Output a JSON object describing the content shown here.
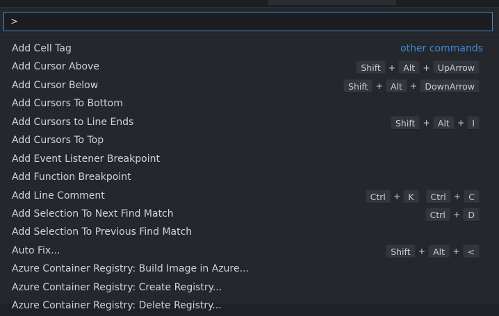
{
  "command_input": {
    "value": ">"
  },
  "other_commands_label": "other commands",
  "commands": [
    {
      "label": "Add Cell Tag",
      "link": true
    },
    {
      "label": "Add Cursor Above",
      "chords": [
        [
          "Shift",
          "Alt",
          "UpArrow"
        ]
      ]
    },
    {
      "label": "Add Cursor Below",
      "chords": [
        [
          "Shift",
          "Alt",
          "DownArrow"
        ]
      ]
    },
    {
      "label": "Add Cursors To Bottom"
    },
    {
      "label": "Add Cursors to Line Ends",
      "chords": [
        [
          "Shift",
          "Alt",
          "I"
        ]
      ]
    },
    {
      "label": "Add Cursors To Top"
    },
    {
      "label": "Add Event Listener Breakpoint"
    },
    {
      "label": "Add Function Breakpoint"
    },
    {
      "label": "Add Line Comment",
      "chords": [
        [
          "Ctrl",
          "K"
        ],
        [
          "Ctrl",
          "C"
        ]
      ]
    },
    {
      "label": "Add Selection To Next Find Match",
      "chords": [
        [
          "Ctrl",
          "D"
        ]
      ]
    },
    {
      "label": "Add Selection To Previous Find Match"
    },
    {
      "label": "Auto Fix...",
      "chords": [
        [
          "Shift",
          "Alt",
          "<"
        ]
      ]
    },
    {
      "label": "Azure Container Registry: Build Image in Azure..."
    },
    {
      "label": "Azure Container Registry: Create Registry..."
    },
    {
      "label": "Azure Container Registry: Delete Registry..."
    }
  ],
  "colors": {
    "accent": "#3f8ad3",
    "link": "#3c8ddb",
    "background": "#24272c",
    "text": "#d1d3d7"
  }
}
